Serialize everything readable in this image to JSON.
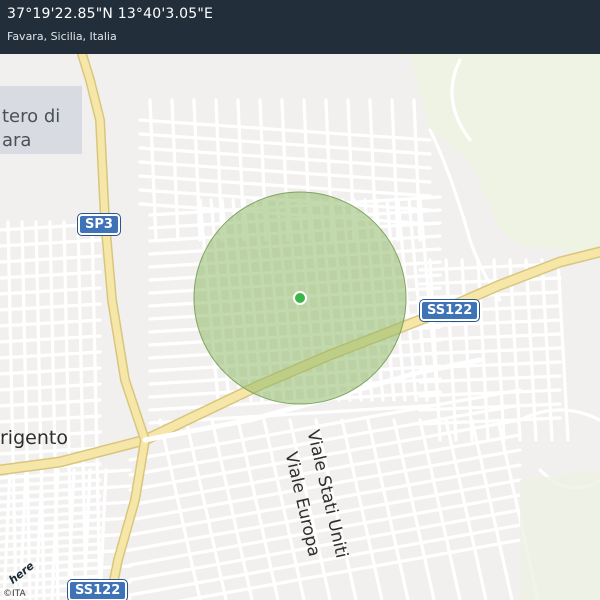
{
  "header": {
    "coordinates": "37°19'22.85\"N 13°40'3.05\"E",
    "location": "Favara, Sicilia, Italia"
  },
  "map": {
    "labels": {
      "poi_line1": "tero di",
      "poi_line2": "ara",
      "town": "rigento",
      "street_stati_uniti": "Viale Stati Uniti",
      "street_europa": "Viale Europa"
    },
    "shields": {
      "sp3": "SP3",
      "ss122_east": "SS122",
      "ss122_south": "SS122"
    },
    "marker": {
      "color": "#3bb54a",
      "accuracy_fill": "#8fba6a"
    },
    "footer": {
      "copyright": "©ITA",
      "logo_text": "here"
    }
  },
  "colors": {
    "header_bg": "#222f3a",
    "land": "#f1f0ee",
    "road": "#ffffff",
    "major_road": "#f6e7a8",
    "shield": "#3f73b8",
    "green_area": "#eef3e3",
    "poi_area": "#d9dbe2"
  }
}
